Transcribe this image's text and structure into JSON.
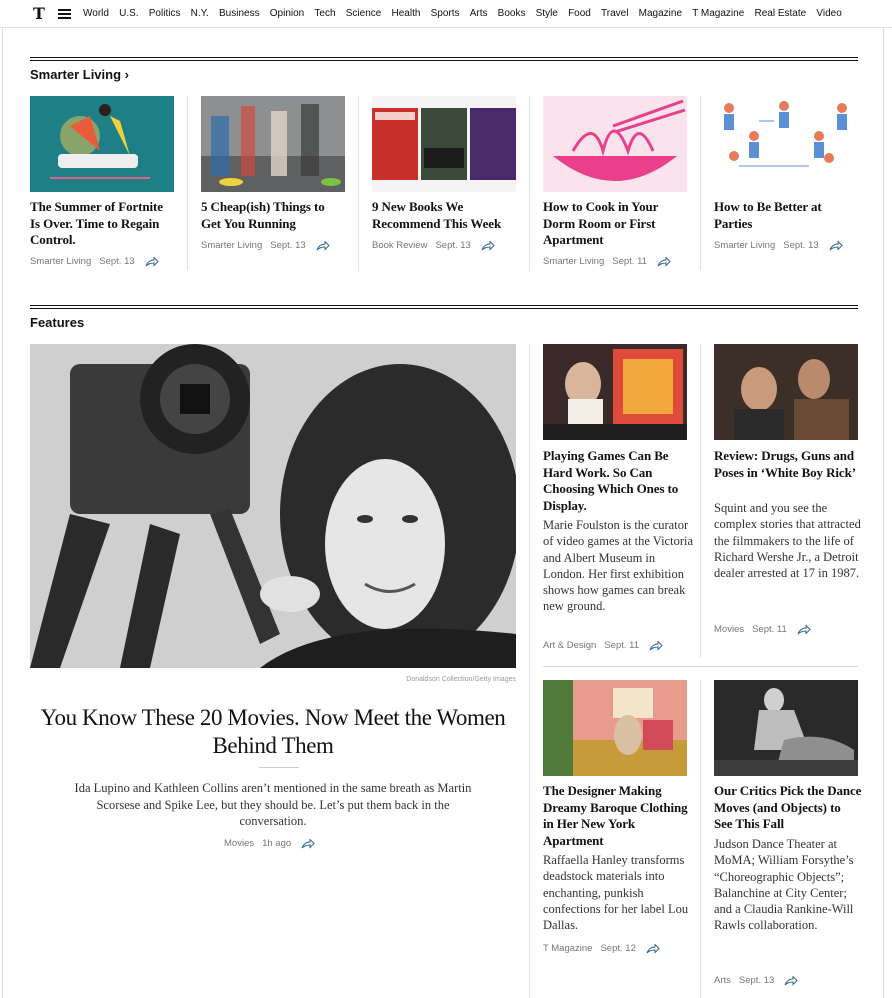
{
  "nav": {
    "logo": "T",
    "links": [
      "World",
      "U.S.",
      "Politics",
      "N.Y.",
      "Business",
      "Opinion",
      "Tech",
      "Science",
      "Health",
      "Sports",
      "Arts",
      "Books",
      "Style",
      "Food",
      "Travel",
      "Magazine",
      "T Magazine",
      "Real Estate",
      "Video"
    ]
  },
  "smarter_living": {
    "title": "Smarter Living ›",
    "cards": [
      {
        "headline": "The Summer of Fortnite Is Over. Time to Regain Control.",
        "section": "Smarter Living",
        "date": "Sept. 13"
      },
      {
        "headline": "5 Cheap(ish) Things to Get You Running",
        "section": "Smarter Living",
        "date": "Sept. 13"
      },
      {
        "headline": "9 New Books We Recommend This Week",
        "section": "Book Review",
        "date": "Sept. 13"
      },
      {
        "headline": "How to Cook in Your Dorm Room or First Apartment",
        "section": "Smarter Living",
        "date": "Sept. 11"
      },
      {
        "headline": "How to Be Better at Parties",
        "section": "Smarter Living",
        "date": "Sept. 13"
      }
    ]
  },
  "features": {
    "title": "Features",
    "lead": {
      "credit": "Donaldson Collection/Getty Images",
      "headline": "You Know These 20 Movies. Now Meet the Women Behind Them",
      "summary": "Ida Lupino and Kathleen Collins aren’t mentioned in the same breath as Martin Scorsese and Spike Lee, but they should be. Let’s put them back in the conversation.",
      "section": "Movies",
      "date": "1h ago"
    },
    "stories": [
      {
        "headline": "Playing Games Can Be Hard Work. So Can Choosing Which Ones to Display.",
        "summary": "Marie Foulston is the curator of video games at the Victoria and Albert Museum in London. Her first exhibition shows how games can break new ground.",
        "section": "Art & Design",
        "date": "Sept. 11"
      },
      {
        "headline": "Review: Drugs, Guns and Poses in ‘White Boy Rick’",
        "summary": "Squint and you see the complex stories that attracted the filmmakers to the life of Richard Wershe Jr., a Detroit dealer arrested at 17 in 1987.",
        "section": "Movies",
        "date": "Sept. 11"
      },
      {
        "headline": "The Designer Making Dreamy Baroque Clothing in Her New York Apartment",
        "summary": "Raffaella Hanley transforms deadstock materials into enchanting, punkish confections for her label Lou Dallas.",
        "section": "T Magazine",
        "date": "Sept. 12"
      },
      {
        "headline": "Our Critics Pick the Dance Moves (and Objects) to See This Fall",
        "summary": "Judson Dance Theater at MoMA; William Forsythe’s “Choreographic Objects”; Balanchine at City Center; and a Claudia Rankine-Will Rawls collaboration.",
        "section": "Arts",
        "date": "Sept. 13"
      }
    ]
  },
  "colors": {
    "accent": "#121212",
    "meta": "#777777",
    "share_icon": "#326891"
  }
}
